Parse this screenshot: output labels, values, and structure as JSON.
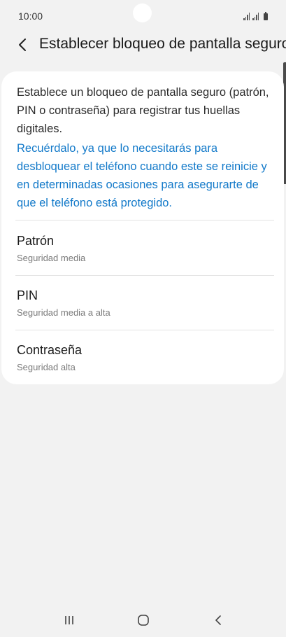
{
  "status_bar": {
    "time": "10:00"
  },
  "header": {
    "title": "Establecer bloqueo de pantalla seguro",
    "back_icon": "chevron-left-icon"
  },
  "card": {
    "description": "Establece un bloqueo de pantalla seguro (patrón, PIN o contraseña) para registrar tus huellas digitales.",
    "reminder": "Recuérdalo, ya que lo necesitarás para desbloquear el teléfono cuando este se reinicie y en determinadas ocasiones para asegurarte de que el teléfono está protegido.",
    "reminder_color": "#1279c9",
    "options": [
      {
        "title": "Patrón",
        "subtitle": "Seguridad media"
      },
      {
        "title": "PIN",
        "subtitle": "Seguridad media a alta"
      },
      {
        "title": "Contraseña",
        "subtitle": "Seguridad alta"
      }
    ]
  },
  "nav_bar": {
    "recent_icon": "recent-apps-icon",
    "home_icon": "home-icon",
    "back_icon": "back-icon"
  }
}
